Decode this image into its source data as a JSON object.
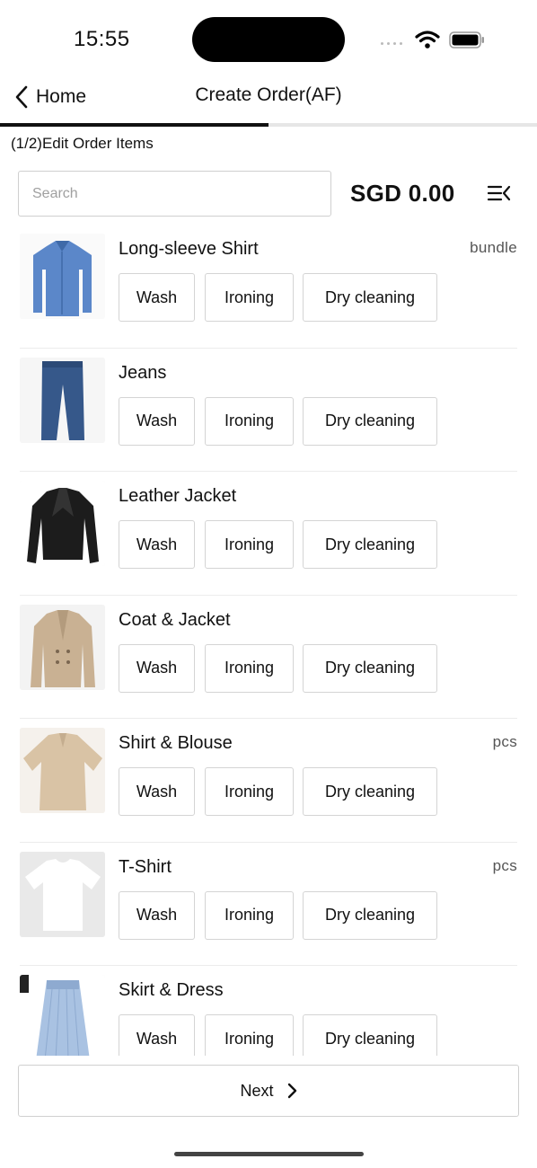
{
  "status": {
    "time": "15:55"
  },
  "nav": {
    "back_label": "Home",
    "title": "Create Order(AF)"
  },
  "progress": {
    "fraction": 0.5
  },
  "step_label": "(1/2)Edit Order Items",
  "search": {
    "placeholder": "Search",
    "value": ""
  },
  "total": "SGD 0.00",
  "items": [
    {
      "name": "Long-sleeve Shirt",
      "unit": "bundle",
      "image": "long-sleeve-shirt-photo",
      "services": [
        "Wash",
        "Ironing",
        "Dry cleaning"
      ]
    },
    {
      "name": "Jeans",
      "unit": "",
      "image": "jeans-photo",
      "services": [
        "Wash",
        "Ironing",
        "Dry cleaning"
      ]
    },
    {
      "name": "Leather Jacket",
      "unit": "",
      "image": "leather-jacket-photo",
      "services": [
        "Wash",
        "Ironing",
        "Dry cleaning"
      ]
    },
    {
      "name": "Coat & Jacket",
      "unit": "",
      "image": "coat-photo",
      "services": [
        "Wash",
        "Ironing",
        "Dry cleaning"
      ]
    },
    {
      "name": "Shirt & Blouse",
      "unit": "pcs",
      "image": "blouse-photo",
      "services": [
        "Wash",
        "Ironing",
        "Dry cleaning"
      ]
    },
    {
      "name": "T-Shirt",
      "unit": "pcs",
      "image": "t-shirt-photo",
      "services": [
        "Wash",
        "Ironing",
        "Dry cleaning"
      ]
    },
    {
      "name": "Skirt & Dress",
      "unit": "",
      "image": "skirt-photo",
      "services": [
        "Wash",
        "Ironing",
        "Dry cleaning"
      ]
    }
  ],
  "next": {
    "label": "Next"
  },
  "icons": {
    "back": "chevron-left-icon",
    "menu": "list-collapse-icon",
    "next": "chevron-right-icon"
  }
}
